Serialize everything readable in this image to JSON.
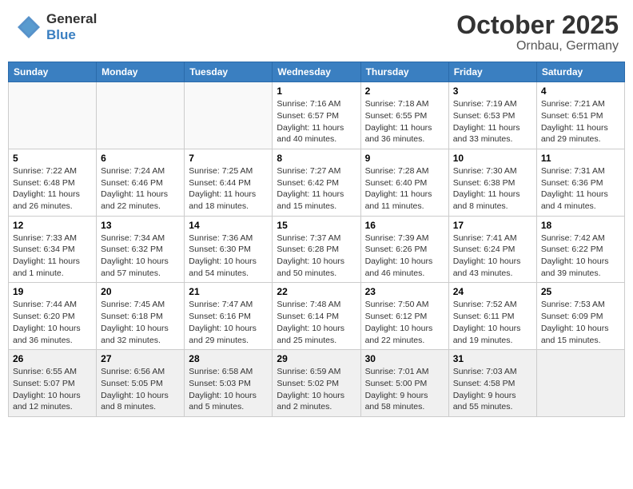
{
  "header": {
    "logo": {
      "general": "General",
      "blue": "Blue"
    },
    "month": "October 2025",
    "location": "Ornbau, Germany"
  },
  "days_of_week": [
    "Sunday",
    "Monday",
    "Tuesday",
    "Wednesday",
    "Thursday",
    "Friday",
    "Saturday"
  ],
  "weeks": [
    [
      {
        "day": "",
        "empty": true
      },
      {
        "day": "",
        "empty": true
      },
      {
        "day": "",
        "empty": true
      },
      {
        "day": "1",
        "sunrise": "7:16 AM",
        "sunset": "6:57 PM",
        "daylight": "11 hours and 40 minutes."
      },
      {
        "day": "2",
        "sunrise": "7:18 AM",
        "sunset": "6:55 PM",
        "daylight": "11 hours and 36 minutes."
      },
      {
        "day": "3",
        "sunrise": "7:19 AM",
        "sunset": "6:53 PM",
        "daylight": "11 hours and 33 minutes."
      },
      {
        "day": "4",
        "sunrise": "7:21 AM",
        "sunset": "6:51 PM",
        "daylight": "11 hours and 29 minutes."
      }
    ],
    [
      {
        "day": "5",
        "sunrise": "7:22 AM",
        "sunset": "6:48 PM",
        "daylight": "11 hours and 26 minutes."
      },
      {
        "day": "6",
        "sunrise": "7:24 AM",
        "sunset": "6:46 PM",
        "daylight": "11 hours and 22 minutes."
      },
      {
        "day": "7",
        "sunrise": "7:25 AM",
        "sunset": "6:44 PM",
        "daylight": "11 hours and 18 minutes."
      },
      {
        "day": "8",
        "sunrise": "7:27 AM",
        "sunset": "6:42 PM",
        "daylight": "11 hours and 15 minutes."
      },
      {
        "day": "9",
        "sunrise": "7:28 AM",
        "sunset": "6:40 PM",
        "daylight": "11 hours and 11 minutes."
      },
      {
        "day": "10",
        "sunrise": "7:30 AM",
        "sunset": "6:38 PM",
        "daylight": "11 hours and 8 minutes."
      },
      {
        "day": "11",
        "sunrise": "7:31 AM",
        "sunset": "6:36 PM",
        "daylight": "11 hours and 4 minutes."
      }
    ],
    [
      {
        "day": "12",
        "sunrise": "7:33 AM",
        "sunset": "6:34 PM",
        "daylight": "11 hours and 1 minute."
      },
      {
        "day": "13",
        "sunrise": "7:34 AM",
        "sunset": "6:32 PM",
        "daylight": "10 hours and 57 minutes."
      },
      {
        "day": "14",
        "sunrise": "7:36 AM",
        "sunset": "6:30 PM",
        "daylight": "10 hours and 54 minutes."
      },
      {
        "day": "15",
        "sunrise": "7:37 AM",
        "sunset": "6:28 PM",
        "daylight": "10 hours and 50 minutes."
      },
      {
        "day": "16",
        "sunrise": "7:39 AM",
        "sunset": "6:26 PM",
        "daylight": "10 hours and 46 minutes."
      },
      {
        "day": "17",
        "sunrise": "7:41 AM",
        "sunset": "6:24 PM",
        "daylight": "10 hours and 43 minutes."
      },
      {
        "day": "18",
        "sunrise": "7:42 AM",
        "sunset": "6:22 PM",
        "daylight": "10 hours and 39 minutes."
      }
    ],
    [
      {
        "day": "19",
        "sunrise": "7:44 AM",
        "sunset": "6:20 PM",
        "daylight": "10 hours and 36 minutes."
      },
      {
        "day": "20",
        "sunrise": "7:45 AM",
        "sunset": "6:18 PM",
        "daylight": "10 hours and 32 minutes."
      },
      {
        "day": "21",
        "sunrise": "7:47 AM",
        "sunset": "6:16 PM",
        "daylight": "10 hours and 29 minutes."
      },
      {
        "day": "22",
        "sunrise": "7:48 AM",
        "sunset": "6:14 PM",
        "daylight": "10 hours and 25 minutes."
      },
      {
        "day": "23",
        "sunrise": "7:50 AM",
        "sunset": "6:12 PM",
        "daylight": "10 hours and 22 minutes."
      },
      {
        "day": "24",
        "sunrise": "7:52 AM",
        "sunset": "6:11 PM",
        "daylight": "10 hours and 19 minutes."
      },
      {
        "day": "25",
        "sunrise": "7:53 AM",
        "sunset": "6:09 PM",
        "daylight": "10 hours and 15 minutes."
      }
    ],
    [
      {
        "day": "26",
        "sunrise": "6:55 AM",
        "sunset": "5:07 PM",
        "daylight": "10 hours and 12 minutes."
      },
      {
        "day": "27",
        "sunrise": "6:56 AM",
        "sunset": "5:05 PM",
        "daylight": "10 hours and 8 minutes."
      },
      {
        "day": "28",
        "sunrise": "6:58 AM",
        "sunset": "5:03 PM",
        "daylight": "10 hours and 5 minutes."
      },
      {
        "day": "29",
        "sunrise": "6:59 AM",
        "sunset": "5:02 PM",
        "daylight": "10 hours and 2 minutes."
      },
      {
        "day": "30",
        "sunrise": "7:01 AM",
        "sunset": "5:00 PM",
        "daylight": "9 hours and 58 minutes."
      },
      {
        "day": "31",
        "sunrise": "7:03 AM",
        "sunset": "4:58 PM",
        "daylight": "9 hours and 55 minutes."
      },
      {
        "day": "",
        "empty": true
      }
    ]
  ]
}
